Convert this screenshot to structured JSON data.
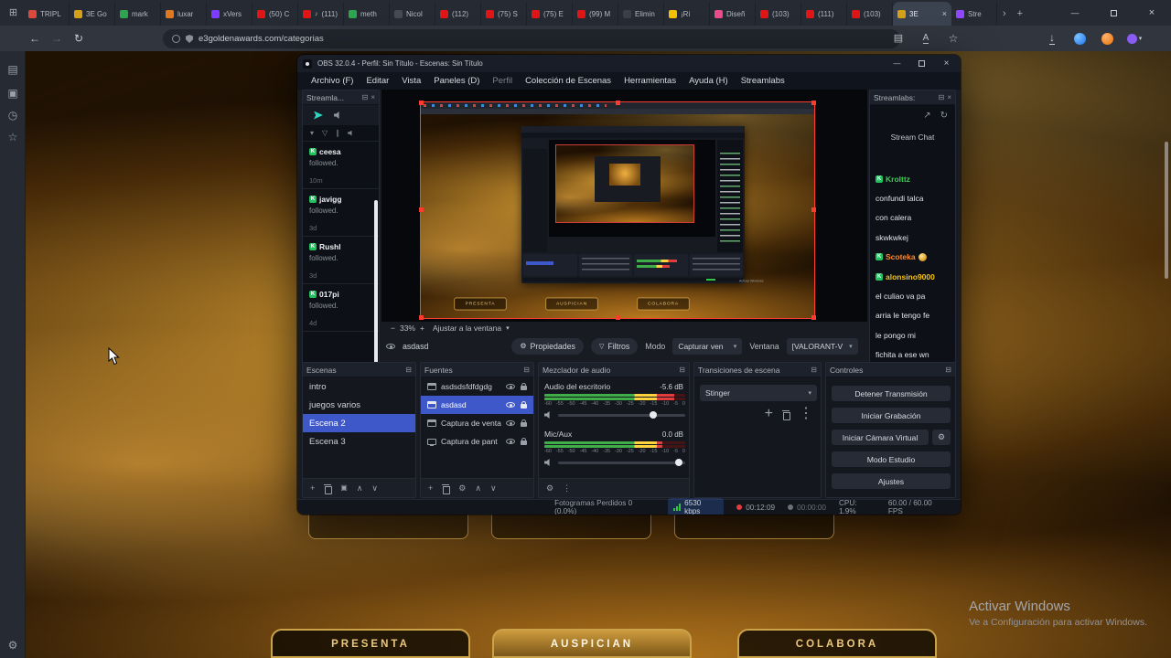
{
  "browser": {
    "address": "e3goldenawards.com/categorias",
    "tabs": [
      {
        "label": "TRIPL",
        "color": "#d94a3c"
      },
      {
        "label": "3E Go",
        "color": "#d4a017"
      },
      {
        "label": "mark",
        "color": "#2ea44f"
      },
      {
        "label": "luxar",
        "color": "#e07820"
      },
      {
        "label": "xVers",
        "color": "#7d3cff"
      },
      {
        "label": "(50) C",
        "color": "#e01616"
      },
      {
        "label": "(111)",
        "color": "#e01616",
        "audio": true
      },
      {
        "label": "meth",
        "color": "#2ea44f"
      },
      {
        "label": "Nicol",
        "color": "#454b54"
      },
      {
        "label": "(112)",
        "color": "#e01616"
      },
      {
        "label": "(75) S",
        "color": "#e01616"
      },
      {
        "label": "(75) E",
        "color": "#e01616"
      },
      {
        "label": "(99) M",
        "color": "#e01616"
      },
      {
        "label": "Elimin",
        "color": "#3a4048"
      },
      {
        "label": "¡Ri",
        "color": "#f2c200"
      },
      {
        "label": "Diseñ",
        "color": "#ea4c89"
      },
      {
        "label": "(103)",
        "color": "#e01616"
      },
      {
        "label": "(111)",
        "color": "#e01616"
      },
      {
        "label": "(103)",
        "color": "#e01616"
      },
      {
        "label": "3E",
        "color": "#d4a017",
        "active": true
      },
      {
        "label": "Stre",
        "color": "#9146ff"
      }
    ]
  },
  "page": {
    "cards": [
      "PRESENTA",
      "AUSPICIAN",
      "COLABORA"
    ],
    "activation": {
      "line1": "Activar Windows",
      "line2": "Ve a Configuración para activar Windows."
    }
  },
  "obs": {
    "title": "OBS 32.0.4 - Perfil: Sin Título - Escenas: Sin Título",
    "menu": [
      "Archivo (F)",
      "Editar",
      "Vista",
      "Paneles (D)",
      "Perfil",
      "Colección de Escenas",
      "Herramientas",
      "Ayuda (H)",
      "Streamlabs"
    ],
    "recent_events": {
      "dock_title": "Streamla...",
      "events": [
        {
          "badge": "K",
          "name": "ceesa",
          "action": "followed.",
          "time": "10m"
        },
        {
          "badge": "K",
          "name": "javigg",
          "action": "followed.",
          "time": "3d"
        },
        {
          "badge": "K",
          "name": "Rushl",
          "action": "followed.",
          "time": "3d"
        },
        {
          "badge": "K",
          "name": "017pi",
          "action": "followed.",
          "time": "4d"
        }
      ]
    },
    "chat": {
      "dock_title": "Streamlabs:",
      "panel_title": "Stream Chat",
      "messages": [
        {
          "badge": "K",
          "user": "Krolttz",
          "color": "#39d353"
        },
        {
          "text": "confundi talca"
        },
        {
          "text": "con calera"
        },
        {
          "text": "skwkwkej"
        },
        {
          "badge": "K",
          "user": "Scoteka",
          "color": "#ff8a2a",
          "emote": "gold-coin"
        },
        {
          "badge": "K",
          "user": "alonsino9000",
          "color": "#f5c518"
        },
        {
          "text": "el culiao va pa"
        },
        {
          "text": "arria le tengo fe"
        },
        {
          "text": "le pongo mi"
        },
        {
          "text": "fichita a ese wn"
        }
      ]
    },
    "preview_bar": {
      "zoom": "33%",
      "fit_label": "Ajustar a la ventana"
    },
    "source_bar": {
      "source_name": "asdasd",
      "properties": "Propiedades",
      "filters": "Filtros",
      "mode_label": "Modo",
      "mode_value": "Capturar ven",
      "window_label": "Ventana",
      "window_value": "[VALORANT-V"
    },
    "scenes": {
      "title": "Escenas",
      "items": [
        "intro",
        "juegos varios",
        "Escena 2",
        "Escena 3"
      ]
    },
    "sources": {
      "title": "Fuentes",
      "items": [
        {
          "name": "asdsdsfdfdgdg"
        },
        {
          "name": "asdasd"
        },
        {
          "name": "Captura de venta"
        },
        {
          "name": "Captura de pant"
        }
      ]
    },
    "mixer": {
      "title": "Mezclador de audio",
      "channels": [
        {
          "name": "Audio del escritorio",
          "db": "-5.6 dB",
          "level": 0.92,
          "slider": 0.75
        },
        {
          "name": "Mic/Aux",
          "db": "0.0 dB",
          "level": 0.84,
          "slider": 0.95
        }
      ],
      "scale": [
        "-60",
        "-55",
        "-50",
        "-45",
        "-40",
        "-35",
        "-30",
        "-25",
        "-20",
        "-15",
        "-10",
        "-5",
        "0"
      ]
    },
    "transitions": {
      "title": "Transiciones de escena",
      "value": "Stinger"
    },
    "controls": {
      "title": "Controles",
      "buttons": [
        "Detener Transmisión",
        "Iniciar Grabación",
        "Iniciar Cámara Virtual",
        "Modo Estudio",
        "Ajustes"
      ]
    },
    "status": {
      "dropped": "Fotogramas Perdidos 0 (0.0%)",
      "bitrate": "6530 kbps",
      "stream_time": "00:12:09",
      "rec_time": "00:00:00",
      "cpu": "CPU: 1.9%",
      "fps": "60.00 / 60.00 FPS"
    }
  }
}
